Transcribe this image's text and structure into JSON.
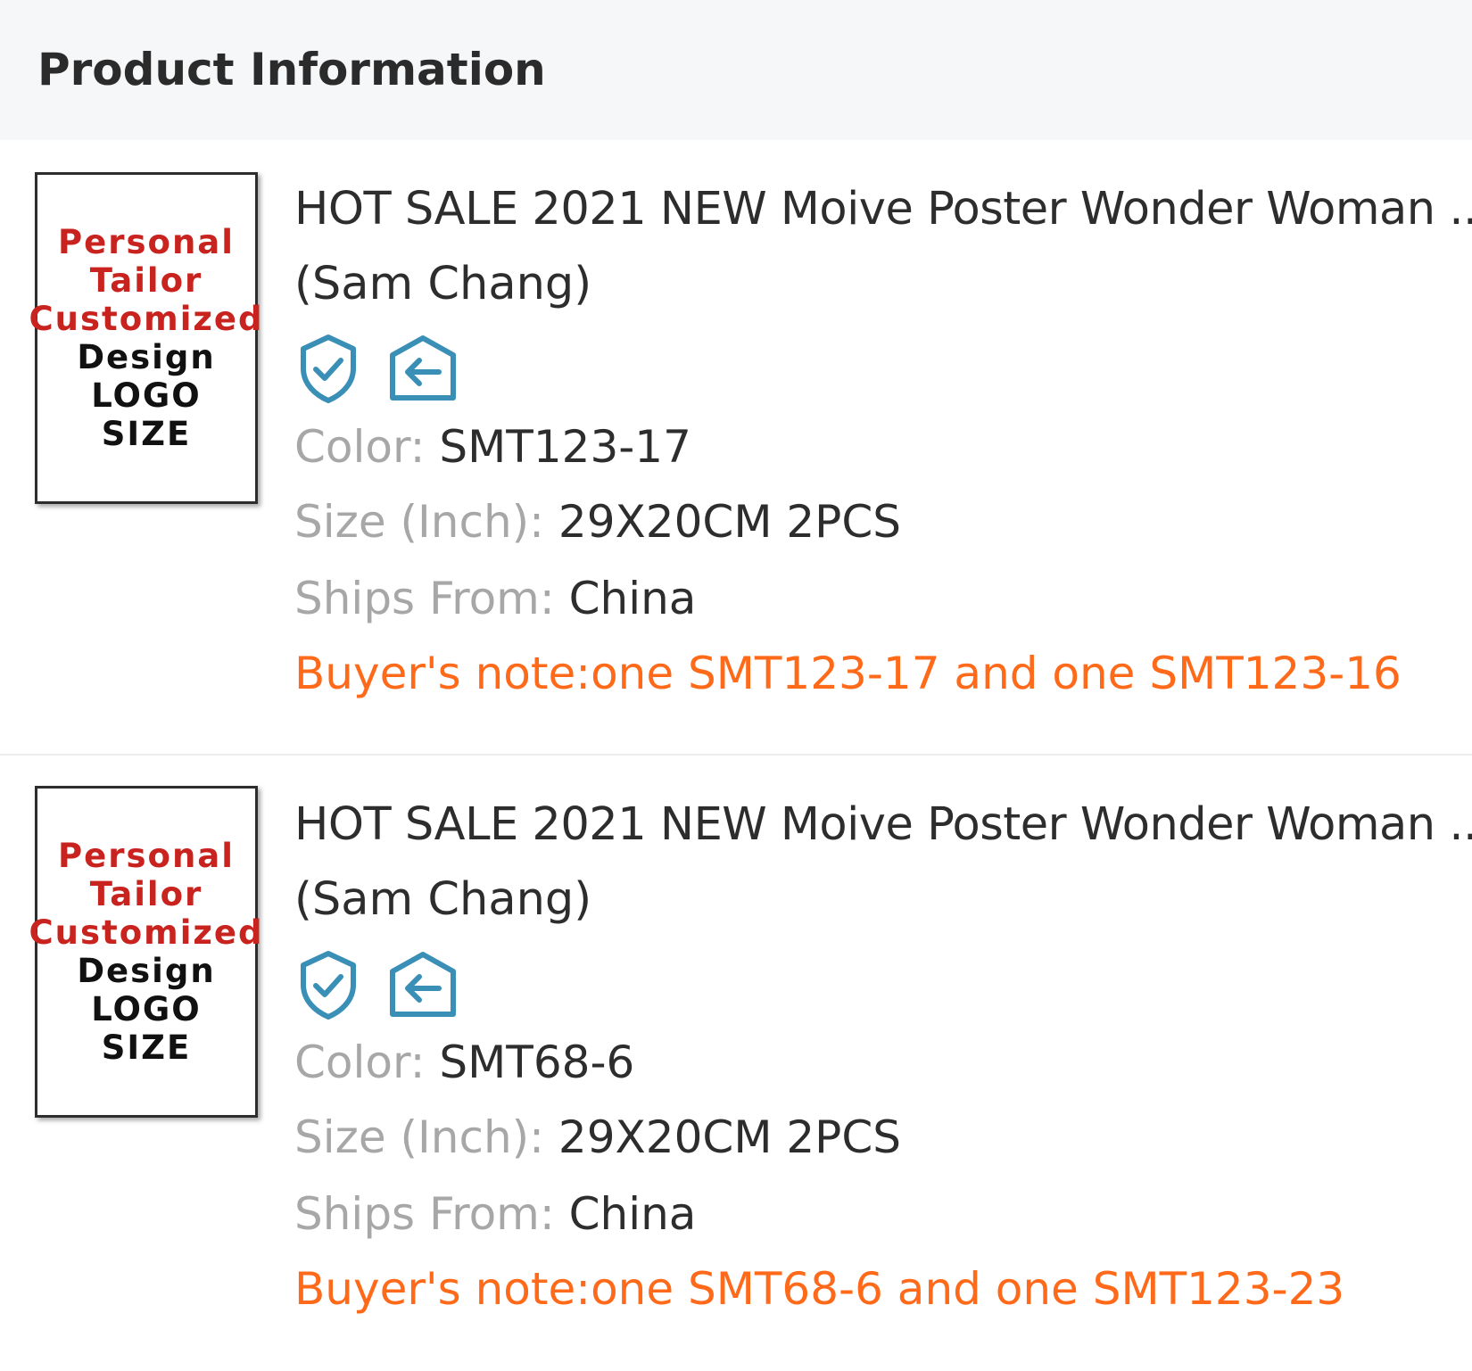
{
  "header": {
    "title": "Product Information"
  },
  "colors": {
    "header_bg": "#f6f7f9",
    "label_gray": "#a7a7a7",
    "value_dark": "#2d2d2d",
    "note_orange": "#ff6a1a",
    "icon_blue": "#3a8fb7",
    "thumb_red": "#c8231e"
  },
  "products": [
    {
      "thumbnail": {
        "line1": "Personal",
        "line2": "Tailor",
        "line3": "Customized",
        "line4": "Design",
        "line5": "LOGO",
        "line6": "SIZE"
      },
      "title": "HOT SALE 2021 NEW Moive Poster Wonder Woman ...",
      "seller": "(Sam Chang)",
      "icons": [
        "shield-check-icon",
        "return-arrow-icon"
      ],
      "color_label": "Color: ",
      "color_value": "SMT123-17",
      "size_label": "Size (Inch): ",
      "size_value": "29X20CM 2PCS",
      "ships_label": "Ships From: ",
      "ships_value": "China",
      "buyer_note": "Buyer's note:one SMT123-17 and one SMT123-16"
    },
    {
      "thumbnail": {
        "line1": "Personal",
        "line2": "Tailor",
        "line3": "Customized",
        "line4": "Design",
        "line5": "LOGO",
        "line6": "SIZE"
      },
      "title": "HOT SALE 2021 NEW Moive Poster Wonder Woman ...",
      "seller": "(Sam Chang)",
      "icons": [
        "shield-check-icon",
        "return-arrow-icon"
      ],
      "color_label": "Color: ",
      "color_value": "SMT68-6",
      "size_label": "Size (Inch): ",
      "size_value": "29X20CM 2PCS",
      "ships_label": "Ships From: ",
      "ships_value": "China",
      "buyer_note": "Buyer's note:one SMT68-6 and one SMT123-23"
    }
  ]
}
